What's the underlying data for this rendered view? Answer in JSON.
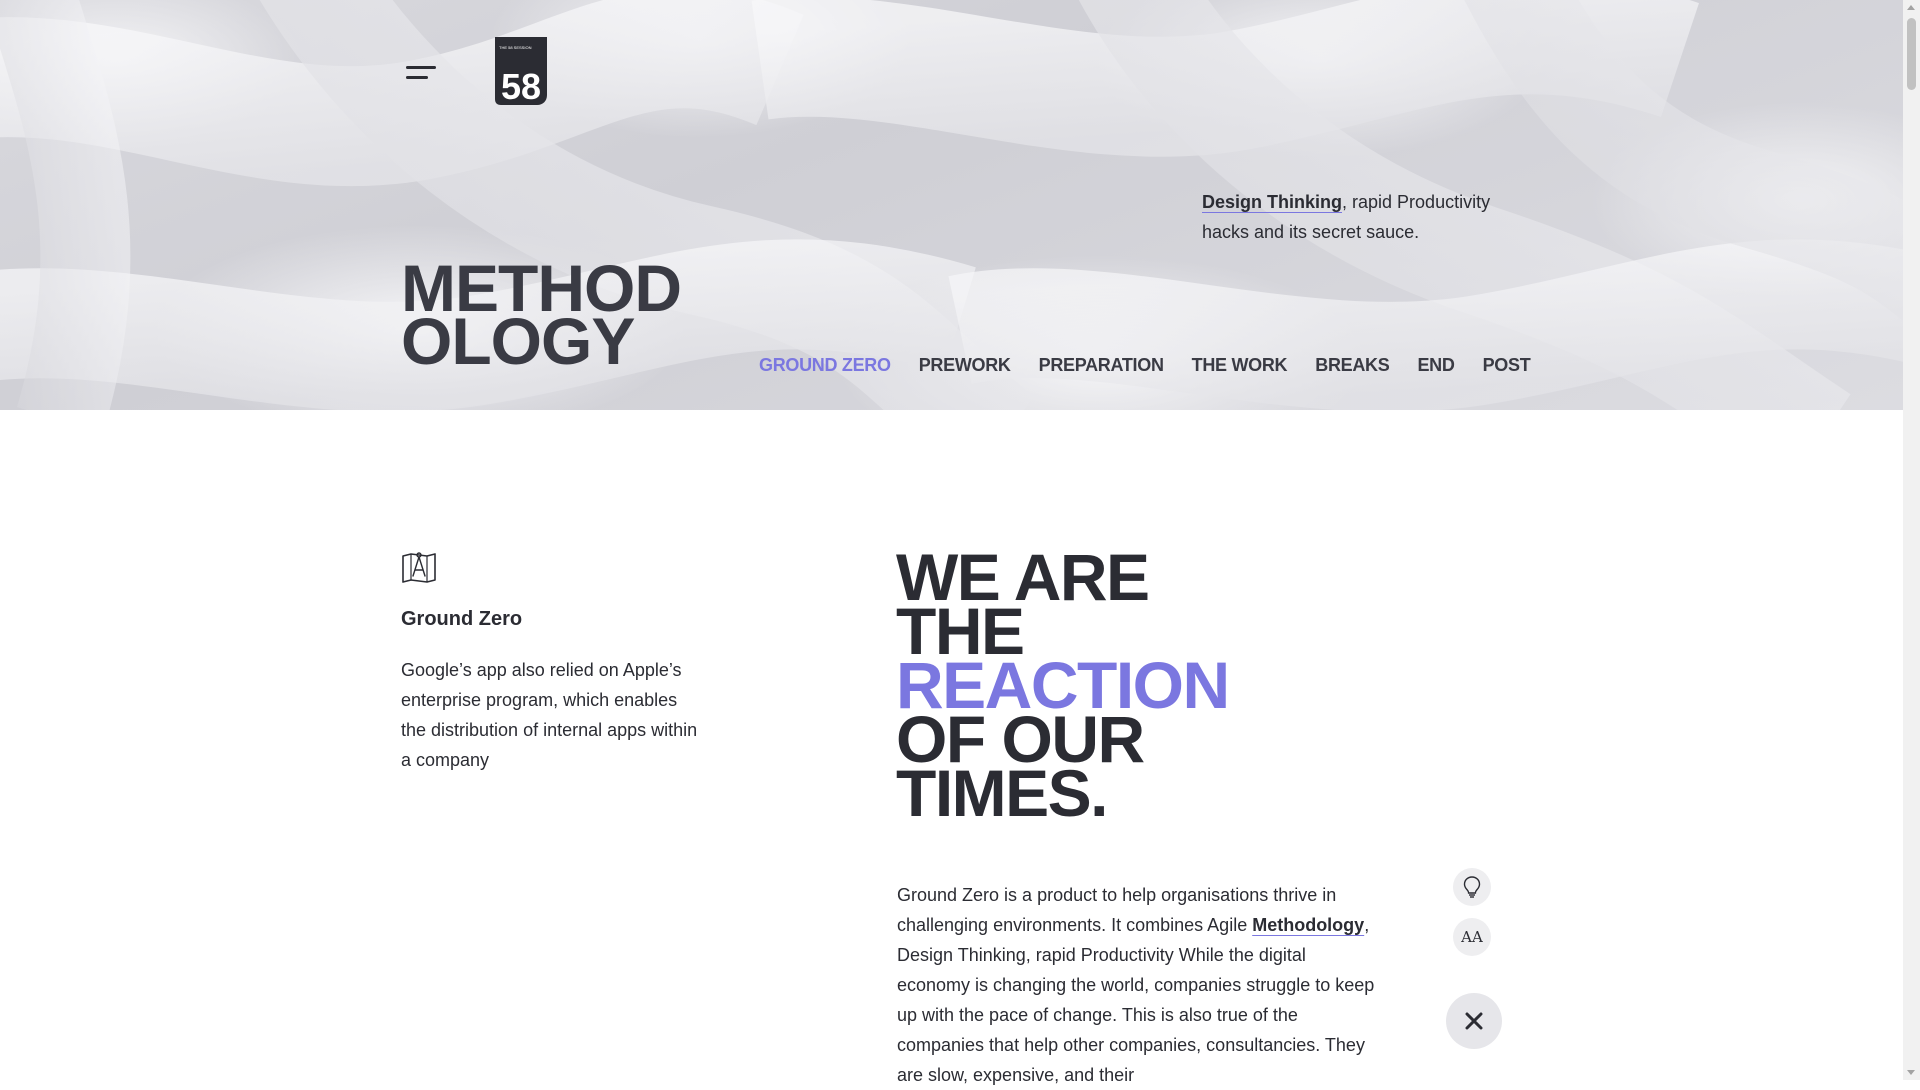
{
  "colors": {
    "accent": "#7b77e0",
    "text": "#2b2c33"
  },
  "header": {
    "logo_text": "THE 58 SESSION",
    "logo_number": "58",
    "tagline_bold": "Design Thinking",
    "tagline_rest": ", rapid Productivity hacks and its secret sauce.",
    "title_line1": "METHOD",
    "title_line2": "OLOGY"
  },
  "section_nav": {
    "items": [
      {
        "label": "GROUND ZERO",
        "active": true
      },
      {
        "label": "PREWORK",
        "active": false
      },
      {
        "label": "PREPARATION",
        "active": false
      },
      {
        "label": "THE WORK",
        "active": false
      },
      {
        "label": "BREAKS",
        "active": false
      },
      {
        "label": "END",
        "active": false
      },
      {
        "label": "POST",
        "active": false
      }
    ]
  },
  "feature": {
    "icon": "map-compass-icon",
    "title": "Ground Zero",
    "text": "Google’s app also relied on Apple’s enterprise program, which enables the distribution of internal apps within a company"
  },
  "headline": {
    "line1": "WE ARE",
    "line2": "THE",
    "line3": "REACTION",
    "line4": "OF OUR",
    "line5": "TIMES."
  },
  "body": {
    "part1": "Ground Zero is a product to help organisations thrive in challenging environments. It combines Agile ",
    "bold": "Methodology",
    "part2": ", Design Thinking, rapid Productivity While the digital economy is changing the world, companies struggle to keep up with the pace of change. This is also true of the companies that help other companies, consultancies. They are slow, expensive, and their"
  },
  "tools": {
    "bulb_icon": "lightbulb-icon",
    "font_label": "AA",
    "close_icon": "close-icon"
  }
}
